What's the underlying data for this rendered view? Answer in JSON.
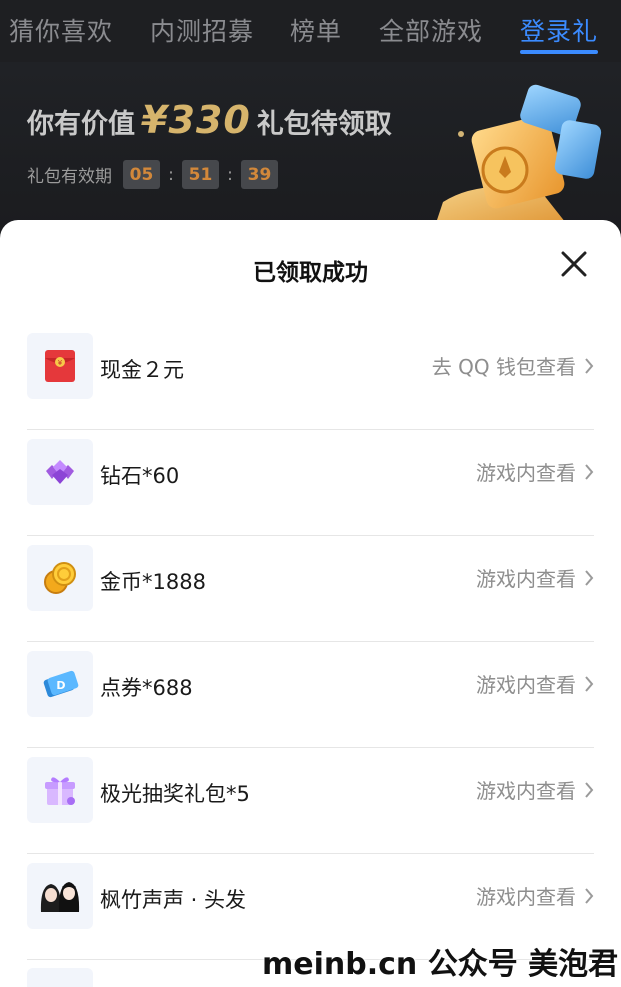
{
  "nav": {
    "tabs": [
      {
        "label": "猜你喜欢"
      },
      {
        "label": "内测招募"
      },
      {
        "label": "榜单"
      },
      {
        "label": "全部游戏"
      },
      {
        "label": "登录礼",
        "active": true
      }
    ],
    "accent": "#3b8bff"
  },
  "promo": {
    "prefix": "你有价值",
    "amount": "¥330",
    "suffix": "礼包待领取",
    "timer_label": "礼包有效期",
    "hours": "05",
    "minutes": "51",
    "seconds": "39",
    "separator": ":"
  },
  "sheet": {
    "title": "已领取成功",
    "close_icon": "close-icon"
  },
  "rewards": [
    {
      "name": "现金２元",
      "action": "去 QQ 钱包查看",
      "icon": "red-envelope-icon"
    },
    {
      "name": "钻石*60",
      "action": "游戏内查看",
      "icon": "diamond-icon"
    },
    {
      "name": "金币*1888",
      "action": "游戏内查看",
      "icon": "gold-coin-icon"
    },
    {
      "name": "点券*688",
      "action": "游戏内查看",
      "icon": "coupon-icon"
    },
    {
      "name": "极光抽奖礼包*5",
      "action": "游戏内查看",
      "icon": "gift-box-icon"
    },
    {
      "name": "枫竹声声 · 头发",
      "action": "游戏内查看",
      "icon": "hair-avatar-icon"
    }
  ],
  "watermark": "meinb.cn  公众号 美泡君"
}
